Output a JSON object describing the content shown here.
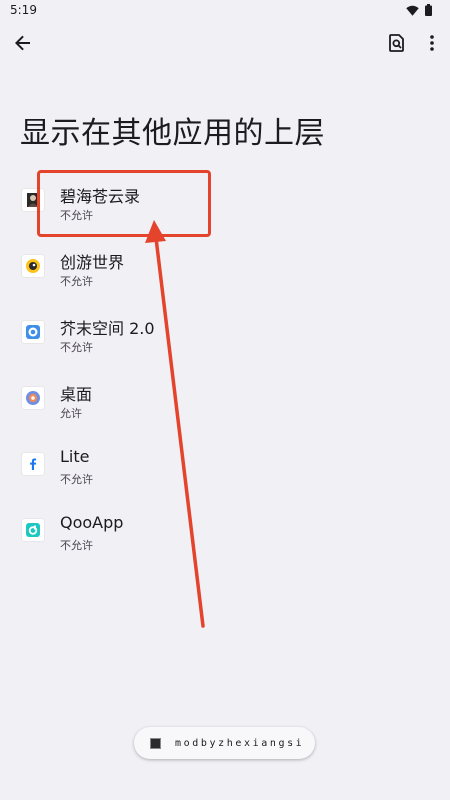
{
  "status_bar": {
    "time": "5:19",
    "icons": [
      "wifi-icon",
      "battery-icon"
    ]
  },
  "top_bar": {
    "back_icon": "arrow-back-icon",
    "search_icon": "search-settings-icon",
    "more_icon": "more-vert-icon"
  },
  "page": {
    "title": "显示在其他应用的上层"
  },
  "apps": [
    {
      "name": "碧海苍云录",
      "status": "不允许",
      "icon": "app-icon-bihai"
    },
    {
      "name": "创游世界",
      "status": "不允许",
      "icon": "app-icon-chuangyou"
    },
    {
      "name": "芥末空间 2.0",
      "status": "不允许",
      "icon": "app-icon-jiemo"
    },
    {
      "name": "桌面",
      "status": "允许",
      "icon": "app-icon-launcher"
    },
    {
      "name": "Lite",
      "status": "不允许",
      "icon": "app-icon-facebook-lite"
    },
    {
      "name": "QooApp",
      "status": "不允许",
      "icon": "app-icon-qooapp"
    }
  ],
  "annotation": {
    "color": "#e4432c"
  },
  "toast": {
    "text": "modbyzhexiangsi"
  }
}
